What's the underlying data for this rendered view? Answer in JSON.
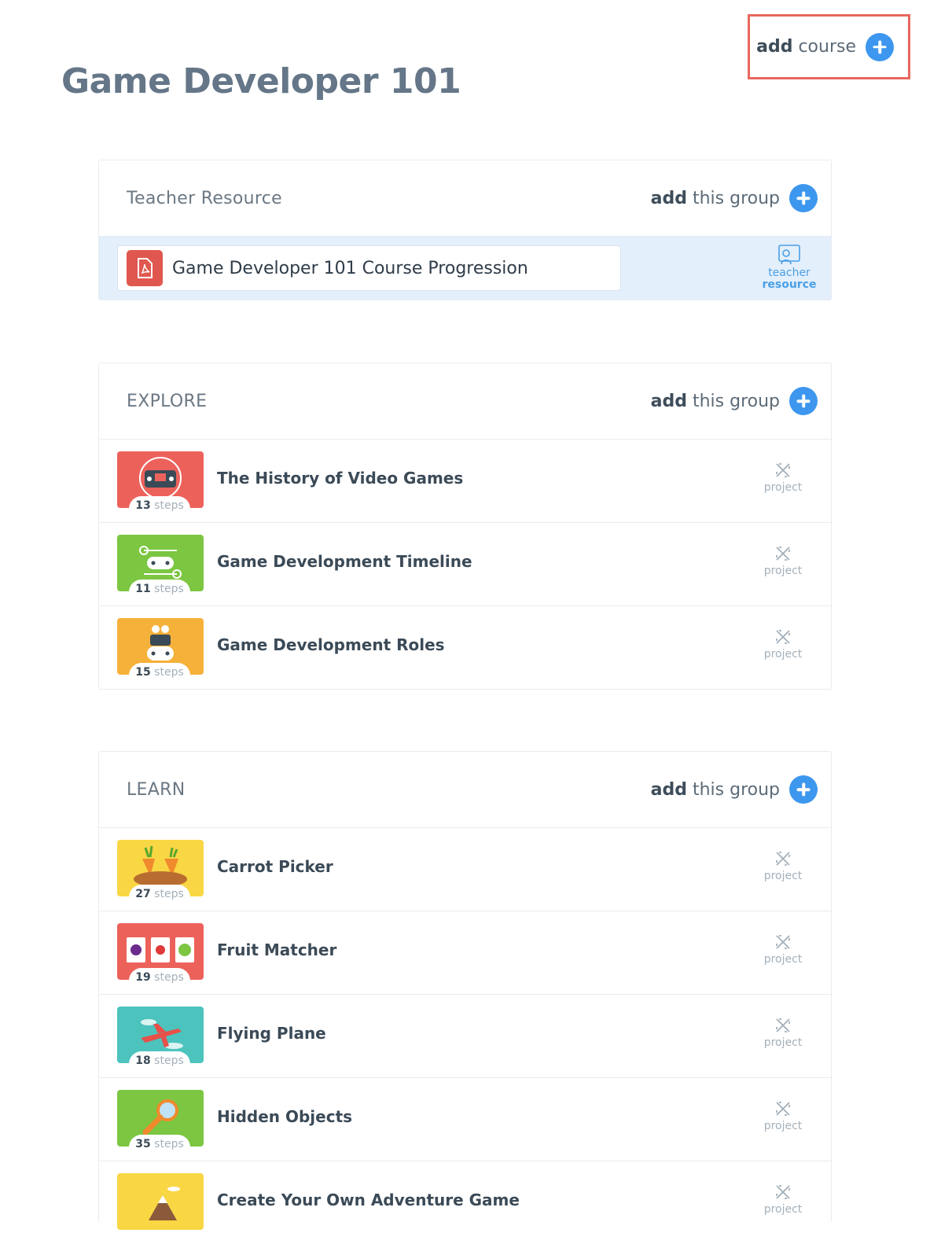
{
  "page": {
    "title": "Game Developer 101"
  },
  "add_course": {
    "bold": "add",
    "rest": "course"
  },
  "add_group": {
    "bold": "add",
    "rest": "this group"
  },
  "colors": {
    "accent": "#3d97ee",
    "highlight_border": "#e8675e",
    "resource_bg": "#e3effb",
    "pdf": "#e0574f"
  },
  "teacher_resource": {
    "group_title": "Teacher Resource",
    "item_title": "Game Developer 101 Course Progression",
    "file_icon": "pdf-icon",
    "badge_line1": "teacher",
    "badge_line2": "resource"
  },
  "explore": {
    "group_title": "EXPLORE",
    "items": [
      {
        "title": "The History of Video Games",
        "steps": "13",
        "steps_word": "steps",
        "tag": "project",
        "thumb_color": "#ec625b",
        "thumb_icon": "retro-console-icon"
      },
      {
        "title": "Game Development Timeline",
        "steps": "11",
        "steps_word": "steps",
        "tag": "project",
        "thumb_color": "#7cc642",
        "thumb_icon": "gamepad-timeline-icon"
      },
      {
        "title": "Game Development Roles",
        "steps": "15",
        "steps_word": "steps",
        "tag": "project",
        "thumb_color": "#f6b13a",
        "thumb_icon": "team-gamepad-icon"
      }
    ]
  },
  "learn": {
    "group_title": "LEARN",
    "items": [
      {
        "title": "Carrot Picker",
        "steps": "27",
        "steps_word": "steps",
        "tag": "project",
        "thumb_color": "#f9d644",
        "thumb_icon": "carrot-icon"
      },
      {
        "title": "Fruit Matcher",
        "steps": "19",
        "steps_word": "steps",
        "tag": "project",
        "thumb_color": "#ec625b",
        "thumb_icon": "fruit-slots-icon"
      },
      {
        "title": "Flying Plane",
        "steps": "18",
        "steps_word": "steps",
        "tag": "project",
        "thumb_color": "#4cc3bd",
        "thumb_icon": "plane-icon"
      },
      {
        "title": "Hidden Objects",
        "steps": "35",
        "steps_word": "steps",
        "tag": "project",
        "thumb_color": "#7cc642",
        "thumb_icon": "magnifier-icon"
      },
      {
        "title": "Create Your Own Adventure Game",
        "steps": "",
        "steps_word": "",
        "tag": "project",
        "thumb_color": "#f9d644",
        "thumb_icon": "mountain-icon"
      }
    ]
  }
}
